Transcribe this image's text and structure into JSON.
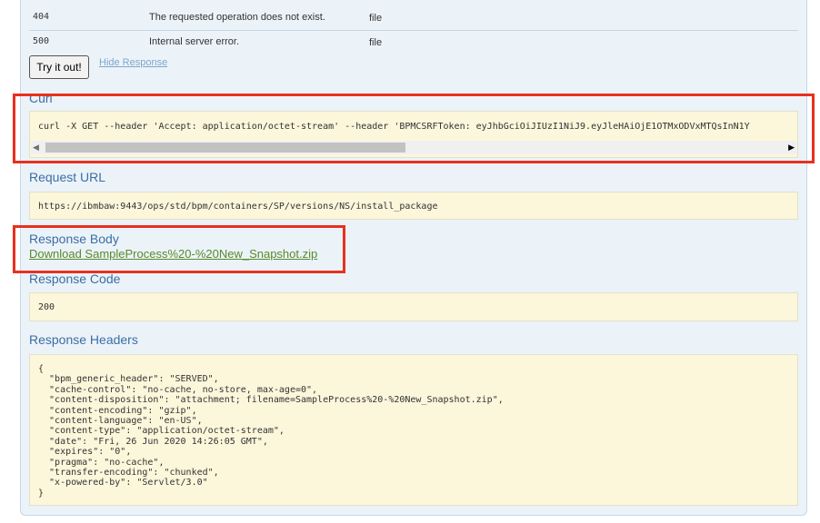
{
  "responses": [
    {
      "code": "404",
      "reason": "The requested operation does not exist.",
      "model": "file"
    },
    {
      "code": "500",
      "reason": "Internal server error.",
      "model": "file"
    }
  ],
  "actions": {
    "try_label": "Try it out!",
    "hide_label": "Hide Response"
  },
  "curl": {
    "label": "Curl",
    "command": "curl -X GET --header 'Accept: application/octet-stream' --header 'BPMCSRFToken: eyJhbGciOiJIUzI1NiJ9.eyJleHAiOjE1OTMxODVxMTQsInN1Y"
  },
  "request_url": {
    "label": "Request URL",
    "value": "https://ibmbaw:9443/ops/std/bpm/containers/SP/versions/NS/install_package"
  },
  "response_body": {
    "label": "Response Body",
    "link": "Download SampleProcess%20-%20New_Snapshot.zip"
  },
  "response_code": {
    "label": "Response Code",
    "value": "200"
  },
  "response_headers": {
    "label": "Response Headers",
    "body": "{\n  \"bpm_generic_header\": \"SERVED\",\n  \"cache-control\": \"no-cache, no-store, max-age=0\",\n  \"content-disposition\": \"attachment; filename=SampleProcess%20-%20New_Snapshot.zip\",\n  \"content-encoding\": \"gzip\",\n  \"content-language\": \"en-US\",\n  \"content-type\": \"application/octet-stream\",\n  \"date\": \"Fri, 26 Jun 2020 14:26:05 GMT\",\n  \"expires\": \"0\",\n  \"pragma\": \"no-cache\",\n  \"transfer-encoding\": \"chunked\",\n  \"x-powered-by\": \"Servlet/3.0\"\n}"
  },
  "scrollbar": {
    "left_arrow": "◀",
    "right_arrow": "▶"
  },
  "colors": {
    "panel_bg": "#ebf3f9",
    "code_bg": "#fcf6db",
    "label_blue": "#3b6ea5",
    "link_green": "#5a8a2a",
    "highlight_red": "#e8301f"
  }
}
